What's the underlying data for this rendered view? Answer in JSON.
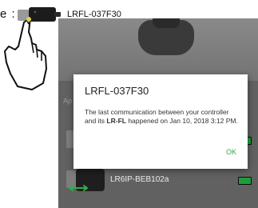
{
  "header": {
    "prefix": "e :",
    "device_label": "LRFL-037F30"
  },
  "list": {
    "section_label": "Ap",
    "rows": [
      {
        "name": "",
        "battery_color": "#1f9d3a"
      },
      {
        "name": "LR6IP-BEB102a",
        "battery_color": "#1f9d3a"
      }
    ]
  },
  "dialog": {
    "title": "LRFL-037F30",
    "body_part1": "The last communication between your controller and its ",
    "body_bold": "LR-FL",
    "body_part2": " happened on Jan 10, 2018 3:12 PM.",
    "ok_label": "OK"
  }
}
